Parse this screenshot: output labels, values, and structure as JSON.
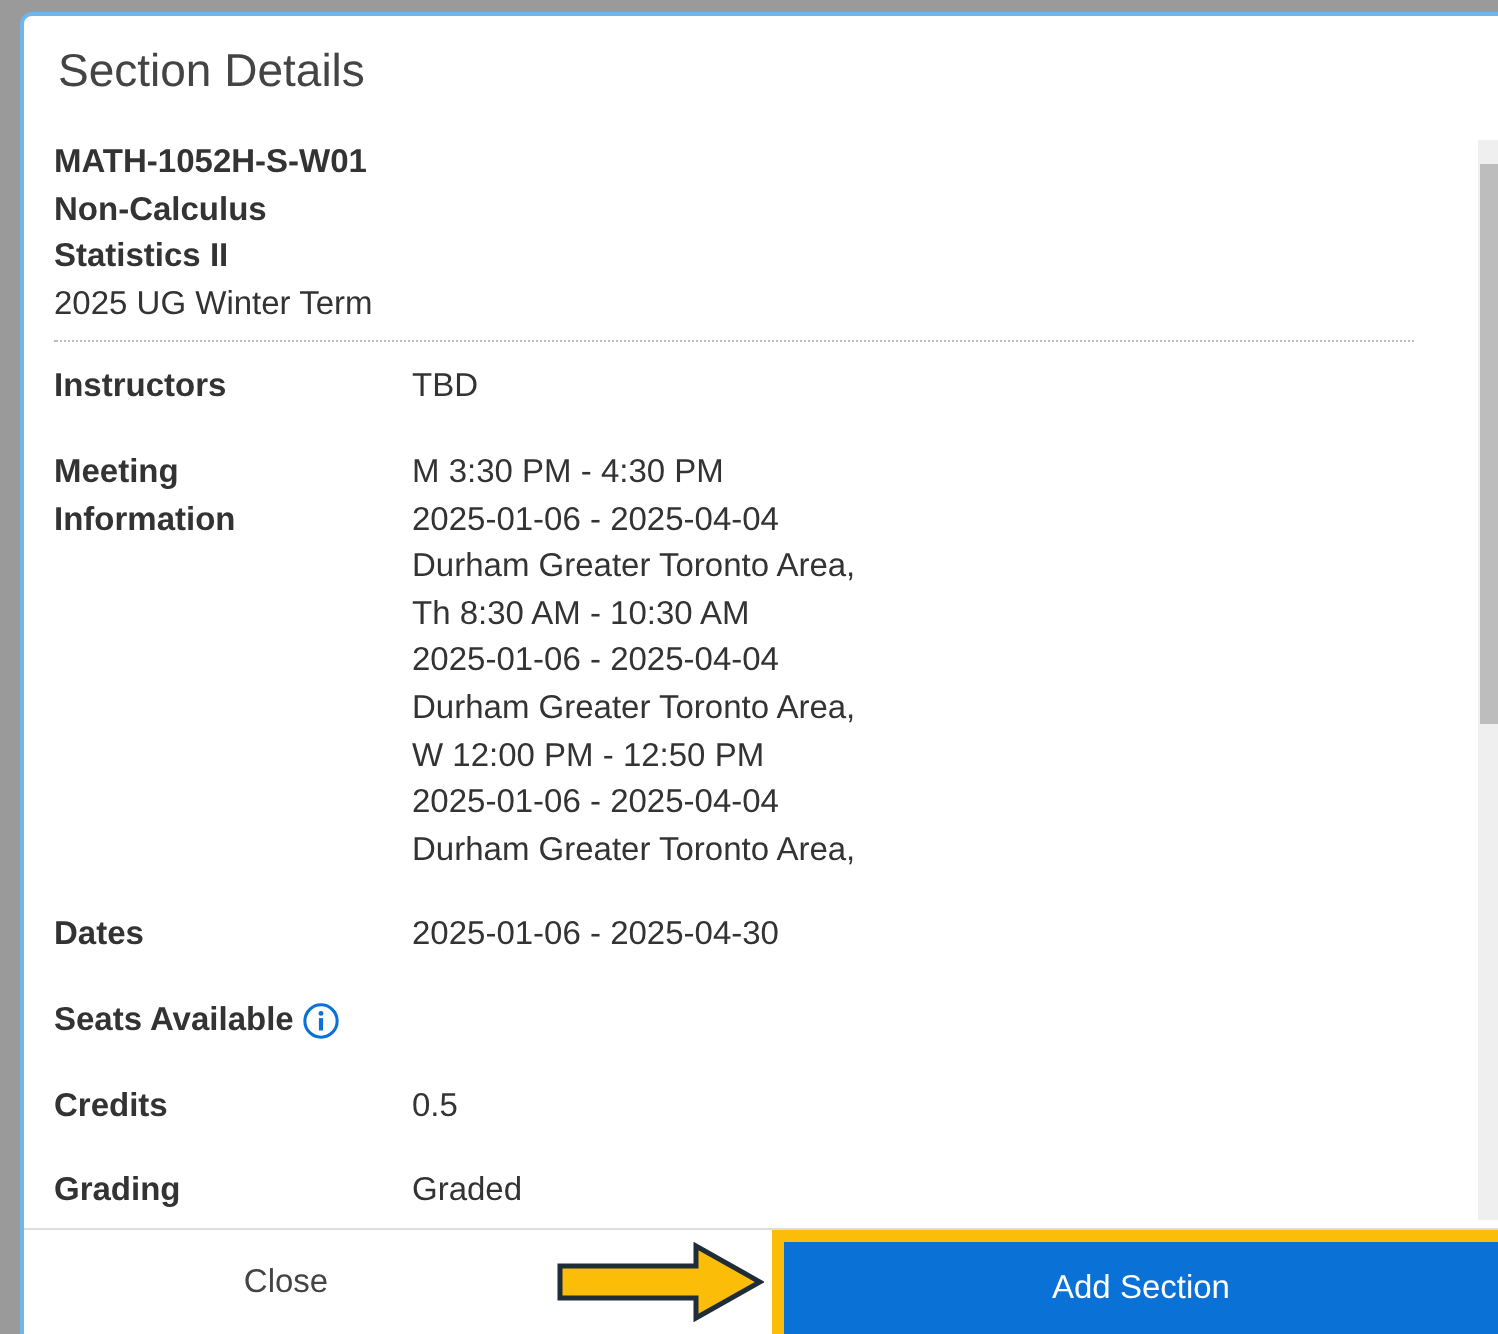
{
  "dialog": {
    "title": "Section Details"
  },
  "section": {
    "name": "MATH-1052H-S-W01 Non-Calculus Statistics II",
    "term": "2025 UG Winter Term"
  },
  "details": [
    {
      "kind": "text",
      "label": "Instructors",
      "value": "TBD"
    },
    {
      "kind": "meetings",
      "label": "Meeting Information",
      "meetings": [
        {
          "time": "M 3:30 PM - 4:30 PM",
          "dates": "2025-01-06 - 2025-04-04",
          "location": "Durham Greater Toronto Area,"
        },
        {
          "time": "Th 8:30 AM - 10:30 AM",
          "dates": "2025-01-06 - 2025-04-04",
          "location": "Durham Greater Toronto Area,"
        },
        {
          "time": "W 12:00 PM - 12:50 PM",
          "dates": "2025-01-06 - 2025-04-04",
          "location": "Durham Greater Toronto Area,"
        }
      ]
    },
    {
      "kind": "text",
      "label": "Dates",
      "value": "2025-01-06 - 2025-04-30"
    },
    {
      "kind": "info",
      "label": "Seats Available"
    },
    {
      "kind": "text",
      "label": "Credits",
      "value": "0.5"
    },
    {
      "kind": "text",
      "label": "Grading",
      "value": "Graded"
    }
  ],
  "footer": {
    "buttons": [
      {
        "label": "Close",
        "kind": "secondary",
        "highlighted": false
      },
      {
        "label": "Add Section",
        "kind": "primary",
        "highlighted": true
      }
    ]
  }
}
